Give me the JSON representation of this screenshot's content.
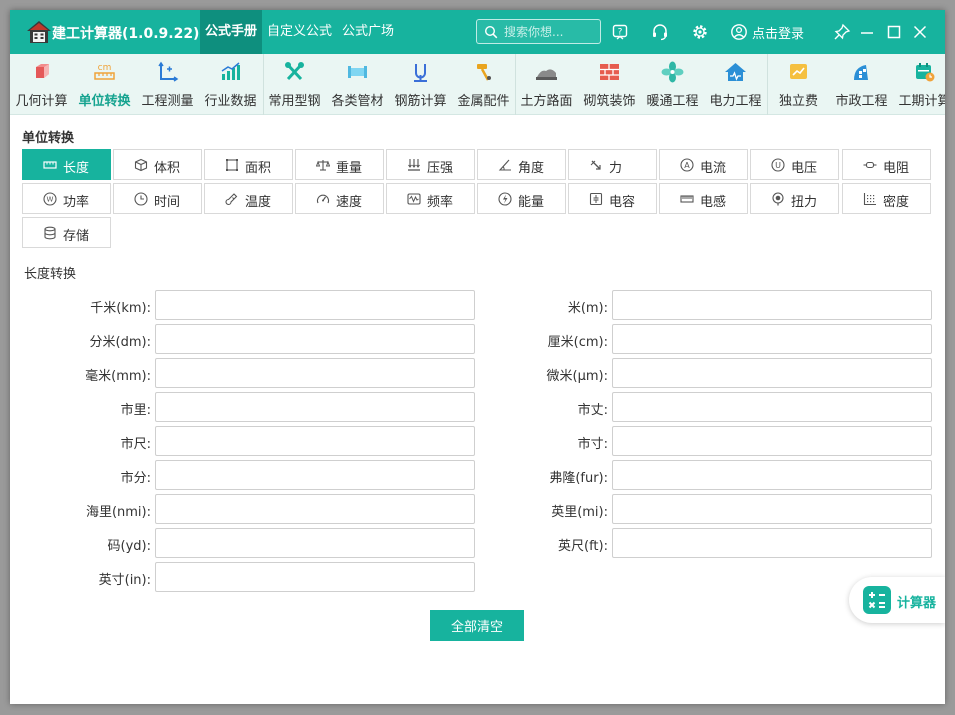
{
  "app": {
    "title": "建工计算器(1.0.9.22)"
  },
  "nav": [
    "公式手册",
    "自定义公式",
    "公式广场"
  ],
  "search": {
    "placeholder": "搜索你想..."
  },
  "login": "点击登录",
  "toolbar": [
    {
      "label": "几何计算",
      "icon": "cube-icon"
    },
    {
      "label": "单位转换",
      "icon": "cm-ruler-icon"
    },
    {
      "label": "工程测量",
      "icon": "axis-icon"
    },
    {
      "label": "行业数据",
      "icon": "bar-chart-icon"
    },
    {
      "label": "常用型钢",
      "icon": "wrench-icon"
    },
    {
      "label": "各类管材",
      "icon": "pipe-icon"
    },
    {
      "label": "钢筋计算",
      "icon": "rebar-icon"
    },
    {
      "label": "金属配件",
      "icon": "hammer-icon"
    },
    {
      "label": "土方路面",
      "icon": "road-icon"
    },
    {
      "label": "砌筑装饰",
      "icon": "brick-icon"
    },
    {
      "label": "暖通工程",
      "icon": "fan-icon"
    },
    {
      "label": "电力工程",
      "icon": "power-house-icon"
    },
    {
      "label": "独立费",
      "icon": "fee-chart-icon"
    },
    {
      "label": "市政工程",
      "icon": "municipal-icon"
    },
    {
      "label": "工期计算",
      "icon": "calendar-icon"
    }
  ],
  "section_title": "单位转换",
  "units": [
    {
      "label": "长度",
      "icon": "ruler-icon"
    },
    {
      "label": "体积",
      "icon": "box-icon"
    },
    {
      "label": "面积",
      "icon": "area-icon"
    },
    {
      "label": "重量",
      "icon": "scale-icon"
    },
    {
      "label": "压强",
      "icon": "pressure-icon"
    },
    {
      "label": "角度",
      "icon": "angle-icon"
    },
    {
      "label": "力",
      "icon": "force-icon"
    },
    {
      "label": "电流",
      "icon": "ampere-icon"
    },
    {
      "label": "电压",
      "icon": "voltage-icon"
    },
    {
      "label": "电阻",
      "icon": "resistor-icon"
    },
    {
      "label": "功率",
      "icon": "watt-icon"
    },
    {
      "label": "时间",
      "icon": "clock-icon"
    },
    {
      "label": "温度",
      "icon": "thermometer-icon"
    },
    {
      "label": "速度",
      "icon": "speedometer-icon"
    },
    {
      "label": "频率",
      "icon": "wave-icon"
    },
    {
      "label": "能量",
      "icon": "energy-icon"
    },
    {
      "label": "电容",
      "icon": "capacitor-icon"
    },
    {
      "label": "电感",
      "icon": "inductor-icon"
    },
    {
      "label": "扭力",
      "icon": "torque-icon"
    },
    {
      "label": "密度",
      "icon": "density-icon"
    },
    {
      "label": "存储",
      "icon": "database-icon"
    }
  ],
  "conversion_title": "长度转换",
  "fields_left": [
    "千米(km):",
    "分米(dm):",
    "毫米(mm):",
    "市里:",
    "市尺:",
    "市分:",
    "海里(nmi):",
    "码(yd):",
    "英寸(in):"
  ],
  "fields_right": [
    "米(m):",
    "厘米(cm):",
    "微米(μm):",
    "市丈:",
    "市寸:",
    "弗隆(fur):",
    "英里(mi):",
    "英尺(ft):"
  ],
  "clear_label": "全部清空",
  "calc_label": "计算器",
  "colors": {
    "accent": "#17b39e",
    "accent_dark": "#0e8f7e",
    "toolbar_bg": "#eaf6f3"
  }
}
